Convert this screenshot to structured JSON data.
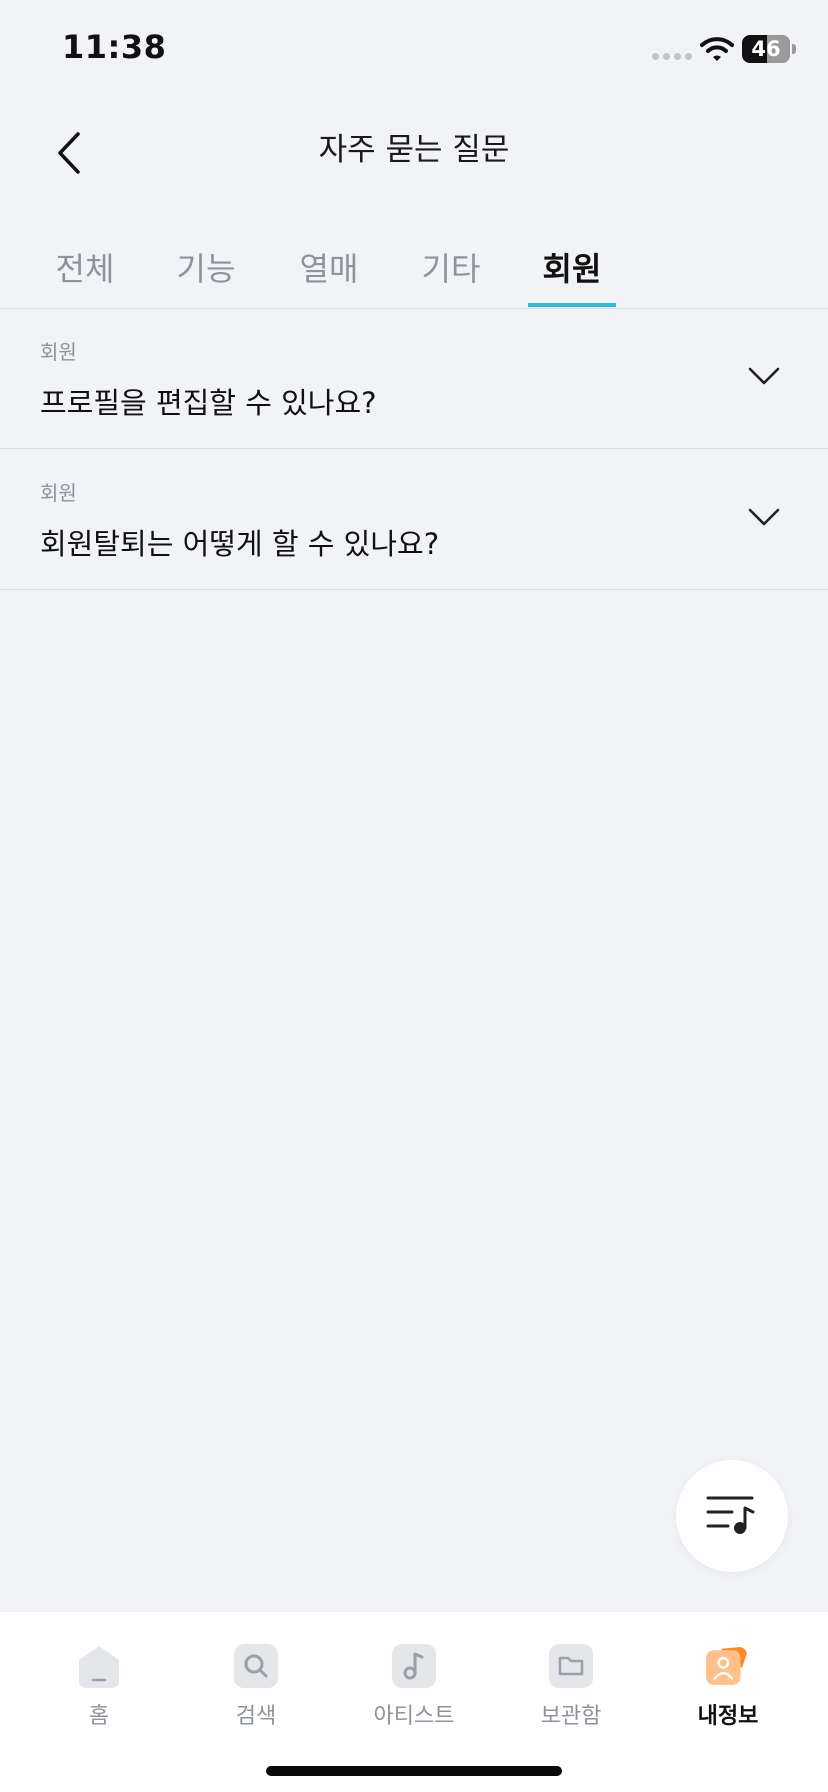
{
  "status_bar": {
    "time": "11:38",
    "battery": "46"
  },
  "header": {
    "title": "자주 묻는 질문"
  },
  "tabs": [
    {
      "label": "전체"
    },
    {
      "label": "기능"
    },
    {
      "label": "열매"
    },
    {
      "label": "기타"
    },
    {
      "label": "회원",
      "active": true
    }
  ],
  "faq_items": [
    {
      "category": "회원",
      "question": "프로필을 편집할 수 있나요?"
    },
    {
      "category": "회원",
      "question": "회원탈퇴는 어떻게 할 수 있나요?"
    }
  ],
  "bottom_nav": [
    {
      "label": "홈",
      "icon": "home-icon"
    },
    {
      "label": "검색",
      "icon": "search-icon"
    },
    {
      "label": "아티스트",
      "icon": "artist-icon"
    },
    {
      "label": "보관함",
      "icon": "folder-icon"
    },
    {
      "label": "내정보",
      "icon": "profile-icon",
      "active": true
    }
  ],
  "colors": {
    "accent": "#2fbcd8",
    "background": "#f1f3f7",
    "profile_orange": "#ff8a1f"
  },
  "fab": {
    "icon": "playlist-icon"
  }
}
